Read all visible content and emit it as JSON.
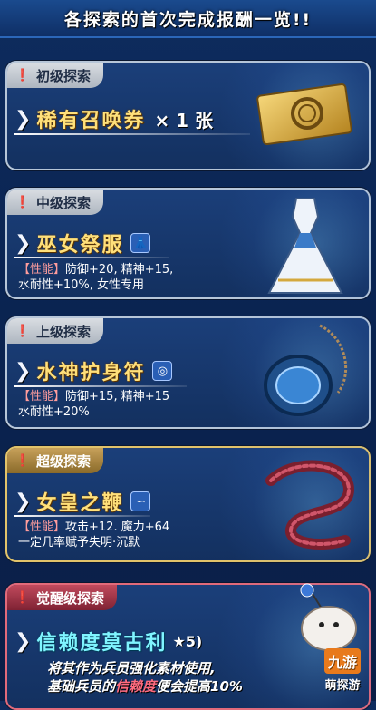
{
  "header": {
    "title": "各探索的首次完成报酬一览!!"
  },
  "cards": [
    {
      "tier": "初级探索",
      "item_name": "稀有召唤券",
      "quantity": "× 1 张",
      "desc_lines": []
    },
    {
      "tier": "中级探索",
      "item_name": "巫女祭服",
      "type_icon": "armor-icon",
      "desc_tag": "【性能】",
      "desc_line1": "防御+20, 精神+15,",
      "desc_line2": "水耐性+10%, 女性专用"
    },
    {
      "tier": "上级探索",
      "item_name": "水神护身符",
      "type_icon": "accessory-icon",
      "desc_tag": "【性能】",
      "desc_line1": "防御+15, 精神+15",
      "desc_line2": "水耐性+20%"
    },
    {
      "tier": "超级探索",
      "item_name": "女皇之鞭",
      "type_icon": "whip-icon",
      "desc_tag": "【性能】",
      "desc_line1": "攻击+12. 魔力+64",
      "desc_line2": "一定几率赋予失明·沉默"
    },
    {
      "tier": "觉醒级探索",
      "item_name": "信赖度莫古利",
      "star_rank": "★5)",
      "footer_line1": "将其作为兵员强化素材使用,",
      "footer_line2_pre": "基础兵员的",
      "footer_line2_hl": "信赖度",
      "footer_line2_post": "便会提高10%"
    }
  ],
  "watermark": {
    "brand": "九游",
    "sub": "萌探游"
  }
}
